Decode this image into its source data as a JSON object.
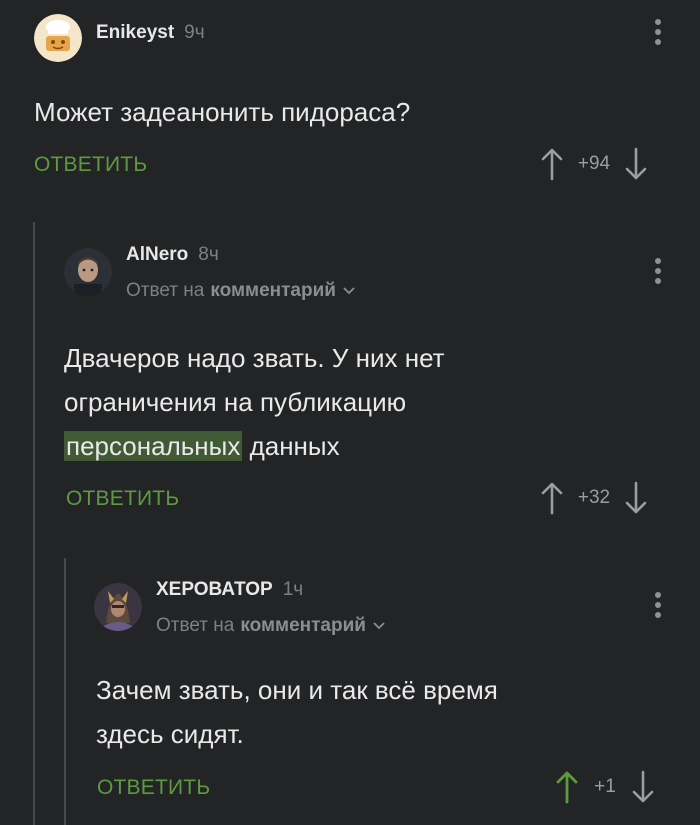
{
  "comments": [
    {
      "author": "Enikeyst",
      "time": "9ч",
      "text": "Может задеанонить пидораса?",
      "reply_label": "ОТВЕТИТЬ",
      "score": "+94"
    },
    {
      "author": "AlNero",
      "time": "8ч",
      "reply_prefix": "Ответ на",
      "reply_target": "комментарий",
      "text_line1": "Двачеров надо звать. У них нет",
      "text_line2": "ограничения на публикацию",
      "text_line3_highlight": "персональных",
      "text_line3_rest": " данных",
      "reply_label": "ОТВЕТИТЬ",
      "score": "+32"
    },
    {
      "author": "ХЕРОВАТОР",
      "time": "1ч",
      "reply_prefix": "Ответ на",
      "reply_target": "комментарий",
      "text_line1": "Зачем звать, они и так всё время",
      "text_line2": "здесь сидят.",
      "reply_label": "ОТВЕТИТЬ",
      "score": "+1",
      "upvoted": true
    }
  ],
  "colors": {
    "background": "#222426",
    "accent": "#5e9a40",
    "highlight": "#3f5a34",
    "muted": "#7d8084"
  }
}
